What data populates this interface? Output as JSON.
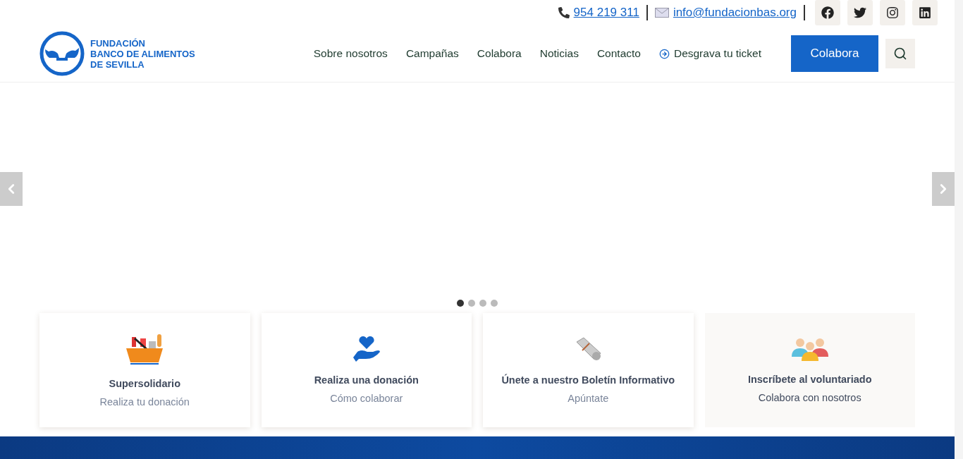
{
  "topbar": {
    "phone": "954 219 311",
    "email": "info@fundacionbas.org",
    "social": [
      {
        "kind": "facebook"
      },
      {
        "kind": "twitter"
      },
      {
        "kind": "instagram"
      },
      {
        "kind": "linkedin"
      }
    ]
  },
  "header": {
    "logo_lines": [
      "FUNDACIÓN",
      "BANCO DE ALIMENTOS",
      "DE SEVILLA"
    ],
    "nav": [
      {
        "label": "Sobre nosotros",
        "kind": "plain"
      },
      {
        "label": "Campañas",
        "kind": "plain"
      },
      {
        "label": "Colabora",
        "kind": "plain"
      },
      {
        "label": "Noticias",
        "kind": "plain"
      },
      {
        "label": "Contacto",
        "kind": "plain"
      },
      {
        "label": "Desgrava tu ticket",
        "kind": "icon"
      }
    ],
    "cta": "Colabora"
  },
  "slider": {
    "dots": [
      {
        "selected": true
      },
      {
        "selected": false
      },
      {
        "selected": false
      },
      {
        "selected": false
      }
    ]
  },
  "cards": [
    {
      "kind": "basket",
      "title": "Supersolidario",
      "subtitle": "Realiza tu donación",
      "highlighted": false
    },
    {
      "kind": "heart",
      "title": "Realiza una donación",
      "subtitle": "Cómo colaborar",
      "highlighted": false
    },
    {
      "kind": "newspaper",
      "title": "Únete a nuestro Boletín Informativo",
      "subtitle": "Apúntate",
      "highlighted": false
    },
    {
      "kind": "people",
      "title": "Inscríbete al voluntariado",
      "subtitle": "Colabora con nosotros",
      "highlighted": true
    }
  ]
}
